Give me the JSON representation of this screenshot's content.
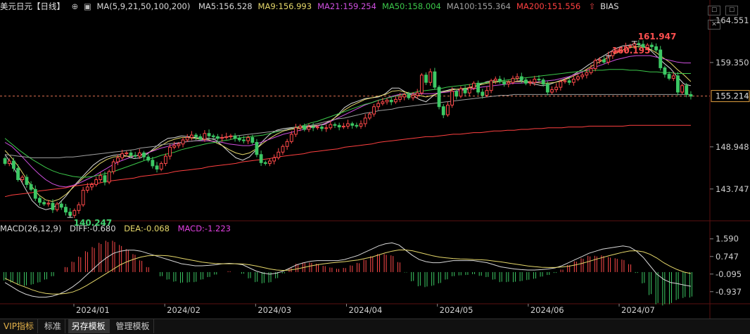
{
  "header": {
    "symbol": "美元日元【日线】",
    "target_icon": "crosshair-icon",
    "chart_icon": "kline-icon",
    "ma_params": "MA(5,9,21,50,100,200)",
    "indicators": [
      {
        "label": "MA5:156.528",
        "color": "#d8d8d8"
      },
      {
        "label": "MA9:156.993",
        "color": "#e6d86a"
      },
      {
        "label": "MA21:159.254",
        "color": "#d050e0"
      },
      {
        "label": "MA50:158.004",
        "color": "#3cc84a"
      },
      {
        "label": "MA100:155.364",
        "color": "#a0a0a0"
      },
      {
        "label": "MA200:151.556",
        "color": "#ff4040"
      }
    ],
    "bias_label": "BIAS"
  },
  "window_buttons": {
    "a": "☐",
    "b": "☐",
    "close": "✕"
  },
  "macd_header": {
    "params": "MACD(26,12,9)",
    "diff": "DIFF:-0.680",
    "dea": "DEA:-0.068",
    "macd": "MACD:-1.223",
    "diff_color": "#d8d8d8",
    "dea_color": "#e6d86a",
    "macd_color": "#e040e0"
  },
  "tabs": [
    {
      "label": "VIP指标"
    },
    {
      "label": "标准"
    },
    {
      "label": "另存模板"
    },
    {
      "label": "管理模板"
    }
  ],
  "colors": {
    "up": "#ff4a4a",
    "down": "#3cc864",
    "grid": "#3a0a0a",
    "axis_text": "#d0d0d0"
  },
  "chart_data": {
    "type": "candlestick",
    "price_axis": {
      "ticks": [
        "164.551",
        "159.350",
        "148.948",
        "143.747"
      ],
      "ylim": [
        140.0,
        165.5
      ]
    },
    "last_price": "155.214",
    "annotations": [
      {
        "label": "160.195",
        "value": 160.195,
        "kind": "high"
      },
      {
        "label": "161.947",
        "value": 161.947,
        "kind": "high"
      },
      {
        "label": "140.247",
        "value": 140.247,
        "kind": "low"
      }
    ],
    "x_labels": [
      "2024/01",
      "2024/02",
      "2024/03",
      "2024/04",
      "2024/05",
      "2024/06",
      "2024/07"
    ],
    "close": [
      146.9,
      147.2,
      146.3,
      144.9,
      145.2,
      144.3,
      143.7,
      142.6,
      142.1,
      141.9,
      142.0,
      141.2,
      141.9,
      141.5,
      140.9,
      140.5,
      141.1,
      141.8,
      143.6,
      144.0,
      144.3,
      144.9,
      145.4,
      144.6,
      145.9,
      147.1,
      147.6,
      148.1,
      148.2,
      147.9,
      147.8,
      148.2,
      147.7,
      147.3,
      146.6,
      146.2,
      146.9,
      147.8,
      148.9,
      149.1,
      149.3,
      149.8,
      150.1,
      150.4,
      150.2,
      149.9,
      150.6,
      150.3,
      150.2,
      150.0,
      150.1,
      150.2,
      150.3,
      150.0,
      149.8,
      149.7,
      150.1,
      149.5,
      148.0,
      147.0,
      146.9,
      147.2,
      147.6,
      148.3,
      149.0,
      149.6,
      150.5,
      151.3,
      151.5,
      151.1,
      151.4,
      151.3,
      151.4,
      151.2,
      151.3,
      151.7,
      151.6,
      151.4,
      151.5,
      151.8,
      151.6,
      151.5,
      151.8,
      152.5,
      153.0,
      153.9,
      154.3,
      154.5,
      154.7,
      154.5,
      154.8,
      155.1,
      155.4,
      155.0,
      155.3,
      155.6,
      157.8,
      156.9,
      158.2,
      156.3,
      153.9,
      152.9,
      154.1,
      155.8,
      155.2,
      156.1,
      155.6,
      156.2,
      156.8,
      155.7,
      155.3,
      155.9,
      157.1,
      157.3,
      157.0,
      156.7,
      156.9,
      157.4,
      157.6,
      157.2,
      156.8,
      156.9,
      157.3,
      157.2,
      156.7,
      155.7,
      156.0,
      156.3,
      157.0,
      157.1,
      156.9,
      157.3,
      157.6,
      157.8,
      158.1,
      158.6,
      159.6,
      159.7,
      159.4,
      160.2,
      160.7,
      160.8,
      160.9,
      161.3,
      161.4,
      161.7,
      161.6,
      161.2,
      161.5,
      161.3,
      160.9,
      158.7,
      157.9,
      157.4,
      157.7,
      155.7,
      156.5,
      155.4,
      155.2
    ],
    "series": [
      {
        "name": "MA5",
        "values": [
          148.0,
          146.8,
          145.3,
          143.8,
          142.3,
          141.5,
          141.2,
          141.4,
          142.0,
          142.9,
          144.0,
          144.9,
          145.8,
          146.7,
          147.3,
          147.7,
          147.9,
          148.0,
          147.8,
          147.5,
          147.6,
          148.1,
          148.8,
          149.5,
          150.0,
          150.1,
          150.3,
          150.2,
          150.1,
          150.0,
          150.0,
          149.8,
          149.1,
          148.3,
          147.6,
          147.3,
          147.7,
          148.6,
          149.7,
          150.5,
          151.0,
          151.2,
          151.3,
          151.4,
          151.4,
          151.5,
          151.6,
          151.7,
          152.1,
          152.9,
          153.8,
          154.3,
          154.6,
          154.9,
          155.0,
          155.1,
          155.5,
          156.2,
          156.2,
          155.7,
          155.3,
          154.8,
          154.5,
          155.2,
          155.7,
          155.9,
          156.1,
          156.0,
          156.1,
          156.3,
          156.7,
          157.0,
          157.1,
          157.0,
          157.0,
          157.0,
          157.1,
          156.9,
          156.7,
          156.5,
          156.6,
          156.9,
          157.2,
          157.5,
          158.0,
          158.5,
          159.1,
          159.6,
          160.1,
          160.6,
          161.1,
          161.4,
          161.5,
          161.6,
          161.4,
          160.9,
          160.1,
          159.3,
          158.6,
          157.6,
          156.7,
          156.5
        ]
      },
      {
        "name": "MA9",
        "values": [
          148.5,
          147.6,
          146.5,
          145.2,
          144.0,
          143.0,
          142.4,
          142.2,
          142.5,
          143.1,
          143.9,
          144.7,
          145.5,
          146.2,
          146.9,
          147.4,
          147.7,
          147.8,
          147.8,
          147.8,
          147.9,
          148.2,
          148.6,
          149.1,
          149.6,
          149.9,
          150.1,
          150.1,
          150.0,
          149.9,
          149.8,
          149.5,
          149.1,
          148.6,
          148.2,
          148.0,
          148.2,
          148.7,
          149.4,
          150.0,
          150.5,
          150.9,
          151.1,
          151.2,
          151.3,
          151.4,
          151.6,
          151.8,
          152.2,
          152.8,
          153.5,
          154.0,
          154.4,
          154.8,
          155.0,
          155.2,
          155.4,
          155.8,
          155.9,
          155.7,
          155.5,
          155.3,
          155.1,
          155.3,
          155.6,
          155.8,
          156.0,
          156.1,
          156.2,
          156.4,
          156.6,
          156.8,
          156.9,
          157.0,
          157.0,
          157.0,
          157.0,
          157.0,
          156.9,
          156.8,
          156.8,
          156.9,
          157.1,
          157.4,
          157.8,
          158.2,
          158.7,
          159.2,
          159.6,
          160.1,
          160.5,
          160.9,
          161.2,
          161.3,
          161.3,
          161.0,
          160.5,
          159.9,
          159.3,
          158.5,
          157.8,
          157.0
        ]
      },
      {
        "name": "MA21",
        "values": [
          149.5,
          149.0,
          148.2,
          147.3,
          146.4,
          145.6,
          144.9,
          144.4,
          144.1,
          144.0,
          144.2,
          144.5,
          144.9,
          145.3,
          145.8,
          146.3,
          146.8,
          147.2,
          147.5,
          147.8,
          148.0,
          148.2,
          148.5,
          148.8,
          149.0,
          149.3,
          149.5,
          149.6,
          149.7,
          149.7,
          149.7,
          149.6,
          149.5,
          149.3,
          149.2,
          149.1,
          149.1,
          149.3,
          149.6,
          149.9,
          150.2,
          150.5,
          150.7,
          150.9,
          151.1,
          151.3,
          151.5,
          151.8,
          152.1,
          152.5,
          152.9,
          153.3,
          153.7,
          154.1,
          154.4,
          154.7,
          154.9,
          155.2,
          155.4,
          155.5,
          155.5,
          155.5,
          155.5,
          155.5,
          155.6,
          155.7,
          155.8,
          155.9,
          156.0,
          156.1,
          156.3,
          156.4,
          156.5,
          156.6,
          156.7,
          156.8,
          156.8,
          156.9,
          156.9,
          157.0,
          157.1,
          157.2,
          157.4,
          157.6,
          157.9,
          158.2,
          158.5,
          158.8,
          159.1,
          159.4,
          159.7,
          159.9,
          160.1,
          160.2,
          160.2,
          160.2,
          160.0,
          159.8,
          159.6,
          159.4,
          159.3,
          159.3
        ]
      },
      {
        "name": "MA50",
        "values": [
          150.0,
          149.3,
          148.6,
          148.0,
          147.4,
          146.9,
          146.4,
          146.0,
          145.7,
          145.5,
          145.3,
          145.2,
          145.2,
          145.3,
          145.5,
          145.7,
          145.9,
          146.2,
          146.5,
          146.8,
          147.1,
          147.4,
          147.6,
          147.9,
          148.1,
          148.3,
          148.6,
          148.8,
          149.0,
          149.2,
          149.4,
          149.5,
          149.7,
          149.8,
          150.0,
          150.1,
          150.2,
          150.3,
          150.4,
          150.6,
          150.8,
          151.0,
          151.2,
          151.4,
          151.6,
          151.9,
          152.1,
          152.4,
          152.7,
          153.0,
          153.3,
          153.6,
          153.9,
          154.2,
          154.4,
          154.7,
          154.9,
          155.1,
          155.3,
          155.5,
          155.6,
          155.8,
          155.9,
          156.0,
          156.1,
          156.3,
          156.4,
          156.5,
          156.6,
          156.7,
          156.8,
          156.9,
          157.0,
          157.1,
          157.2,
          157.3,
          157.4,
          157.5,
          157.6,
          157.7,
          157.8,
          157.9,
          158.0,
          158.1,
          158.2,
          158.3,
          158.3,
          158.4,
          158.4,
          158.5,
          158.5,
          158.5,
          158.4,
          158.4,
          158.3,
          158.2,
          158.2,
          158.1,
          158.1,
          158.0,
          158.0,
          158.0
        ]
      },
      {
        "name": "MA100",
        "values": [
          148.0,
          147.9,
          147.8,
          147.7,
          147.6,
          147.6,
          147.6,
          147.6,
          147.6,
          147.7,
          147.7,
          147.8,
          147.9,
          148.0,
          148.1,
          148.2,
          148.3,
          148.4,
          148.5,
          148.6,
          148.8,
          148.9,
          149.0,
          149.2,
          149.3,
          149.4,
          149.5,
          149.6,
          149.7,
          149.8,
          149.9,
          150.0,
          150.1,
          150.2,
          150.3,
          150.4,
          150.5,
          150.6,
          150.7,
          150.8,
          150.9,
          151.0,
          151.2,
          151.3,
          151.5,
          151.6,
          151.8,
          152.0,
          152.2,
          152.4,
          152.5,
          152.7,
          152.9,
          153.1,
          153.2,
          153.4,
          153.5,
          153.6,
          153.8,
          153.9,
          154.0,
          154.1,
          154.2,
          154.3,
          154.4,
          154.5,
          154.6,
          154.7,
          154.8,
          154.9,
          155.0,
          155.1,
          155.2,
          155.3,
          155.3,
          155.4,
          155.4,
          155.4,
          155.4,
          155.4,
          155.4,
          155.4,
          155.4,
          155.4,
          155.4,
          155.4,
          155.4,
          155.4,
          155.4,
          155.4,
          155.4,
          155.4,
          155.4,
          155.4,
          155.4,
          155.4,
          155.4,
          155.4,
          155.4,
          155.4,
          155.4,
          155.4
        ]
      },
      {
        "name": "MA200",
        "values": [
          142.8,
          143.0,
          143.1,
          143.2,
          143.3,
          143.5,
          143.6,
          143.7,
          143.8,
          143.9,
          144.1,
          144.2,
          144.3,
          144.4,
          144.5,
          144.7,
          144.8,
          144.9,
          145.0,
          145.1,
          145.3,
          145.4,
          145.5,
          145.6,
          145.7,
          145.9,
          146.0,
          146.1,
          146.2,
          146.3,
          146.5,
          146.6,
          146.7,
          146.8,
          146.9,
          147.1,
          147.2,
          147.3,
          147.4,
          147.5,
          147.7,
          147.8,
          147.9,
          148.0,
          148.1,
          148.3,
          148.4,
          148.5,
          148.6,
          148.7,
          148.9,
          149.0,
          149.1,
          149.2,
          149.3,
          149.5,
          149.6,
          149.7,
          149.8,
          149.9,
          150.0,
          150.1,
          150.2,
          150.2,
          150.3,
          150.4,
          150.5,
          150.5,
          150.6,
          150.7,
          150.7,
          150.8,
          150.9,
          150.9,
          151.0,
          151.0,
          151.1,
          151.1,
          151.2,
          151.2,
          151.3,
          151.3,
          151.3,
          151.4,
          151.4,
          151.4,
          151.5,
          151.5,
          151.5,
          151.5,
          151.5,
          151.5,
          151.6,
          151.6,
          151.6,
          151.6,
          151.6,
          151.6,
          151.6,
          151.6,
          151.6,
          151.6
        ]
      }
    ],
    "macd_panel": {
      "ticks": [
        "1.590",
        "0.747",
        "-0.095",
        "-0.937"
      ],
      "ylim": [
        -1.45,
        1.85
      ],
      "diff": [
        -0.5,
        -0.7,
        -0.9,
        -1.05,
        -1.15,
        -1.2,
        -1.2,
        -1.15,
        -1.05,
        -0.9,
        -0.7,
        -0.45,
        -0.15,
        0.15,
        0.45,
        0.7,
        0.9,
        1.0,
        1.05,
        1.05,
        1.0,
        0.9,
        0.8,
        0.7,
        0.6,
        0.5,
        0.4,
        0.35,
        0.3,
        0.3,
        0.32,
        0.35,
        0.4,
        0.42,
        0.4,
        0.35,
        0.2,
        0.05,
        -0.05,
        -0.1,
        -0.05,
        0.05,
        0.2,
        0.35,
        0.45,
        0.52,
        0.55,
        0.55,
        0.55,
        0.55,
        0.6,
        0.7,
        0.8,
        0.95,
        1.1,
        1.25,
        1.35,
        1.4,
        1.3,
        1.05,
        0.8,
        0.6,
        0.5,
        0.45,
        0.45,
        0.5,
        0.55,
        0.55,
        0.55,
        0.55,
        0.5,
        0.45,
        0.35,
        0.25,
        0.2,
        0.15,
        0.12,
        0.1,
        0.1,
        0.12,
        0.15,
        0.2,
        0.3,
        0.45,
        0.6,
        0.75,
        0.9,
        1.0,
        1.1,
        1.15,
        1.2,
        1.25,
        1.2,
        1.0,
        0.7,
        0.3,
        -0.1,
        -0.35,
        -0.5,
        -0.55,
        -0.62,
        -0.68
      ],
      "dea": [
        -0.3,
        -0.45,
        -0.6,
        -0.72,
        -0.85,
        -0.95,
        -1.02,
        -1.05,
        -1.05,
        -1.02,
        -0.95,
        -0.82,
        -0.65,
        -0.45,
        -0.25,
        -0.05,
        0.15,
        0.35,
        0.5,
        0.62,
        0.72,
        0.78,
        0.8,
        0.8,
        0.78,
        0.73,
        0.66,
        0.6,
        0.54,
        0.48,
        0.44,
        0.41,
        0.4,
        0.4,
        0.4,
        0.39,
        0.35,
        0.29,
        0.22,
        0.15,
        0.1,
        0.08,
        0.1,
        0.15,
        0.22,
        0.29,
        0.35,
        0.4,
        0.44,
        0.47,
        0.5,
        0.54,
        0.58,
        0.65,
        0.72,
        0.82,
        0.92,
        1.0,
        1.06,
        1.06,
        1.02,
        0.94,
        0.86,
        0.78,
        0.72,
        0.68,
        0.65,
        0.63,
        0.62,
        0.6,
        0.59,
        0.57,
        0.53,
        0.49,
        0.44,
        0.39,
        0.34,
        0.29,
        0.26,
        0.23,
        0.22,
        0.22,
        0.24,
        0.28,
        0.34,
        0.42,
        0.51,
        0.61,
        0.7,
        0.79,
        0.87,
        0.95,
        1.01,
        1.02,
        0.97,
        0.85,
        0.67,
        0.45,
        0.27,
        0.12,
        0.0,
        -0.07
      ],
      "macd": [
        -0.4,
        -0.5,
        -0.6,
        -0.66,
        -0.6,
        -0.5,
        -0.36,
        -0.2,
        0.0,
        0.24,
        0.5,
        0.74,
        1.0,
        1.2,
        1.4,
        1.5,
        1.5,
        1.3,
        1.1,
        0.86,
        0.56,
        0.24,
        0.0,
        -0.2,
        -0.36,
        -0.46,
        -0.52,
        -0.5,
        -0.48,
        -0.36,
        -0.24,
        -0.12,
        0.0,
        0.04,
        0.0,
        -0.08,
        -0.3,
        -0.48,
        -0.54,
        -0.5,
        -0.3,
        -0.06,
        0.2,
        0.4,
        0.46,
        0.46,
        0.4,
        0.3,
        0.22,
        0.16,
        0.2,
        0.32,
        0.44,
        0.6,
        0.76,
        0.86,
        0.86,
        0.8,
        0.48,
        -0.02,
        -0.44,
        -0.68,
        -0.72,
        -0.66,
        -0.54,
        -0.36,
        -0.2,
        -0.16,
        -0.14,
        -0.1,
        -0.18,
        -0.24,
        -0.36,
        -0.48,
        -0.48,
        -0.48,
        -0.44,
        -0.38,
        -0.32,
        -0.22,
        -0.14,
        -0.04,
        0.12,
        0.34,
        0.52,
        0.66,
        0.78,
        0.78,
        0.8,
        0.72,
        0.66,
        0.6,
        0.38,
        -0.04,
        -0.54,
        -1.1,
        -1.54,
        -1.6,
        -1.54,
        -1.34,
        -1.24,
        -1.22
      ]
    }
  }
}
